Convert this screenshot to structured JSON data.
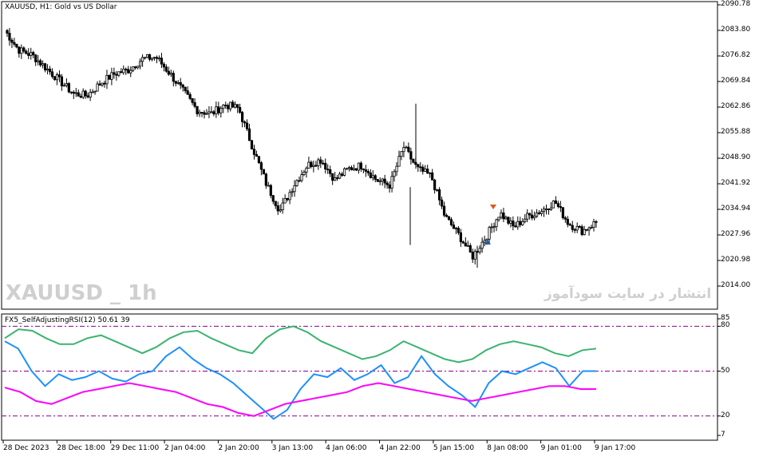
{
  "main_chart": {
    "title": "XAUUSD, H1:  Gold vs US Dollar",
    "price_ticks": [
      "2090.78",
      "2083.80",
      "2076.82",
      "2069.84",
      "2062.86",
      "2055.88",
      "2048.90",
      "2041.92",
      "2034.94",
      "2027.96",
      "2020.98",
      "2014.00"
    ],
    "watermark_left": "XAUUSD _ 1h",
    "watermark_right": "انتشار در سایت سودآموز"
  },
  "indicator": {
    "title": "FX5_SelfAdjustingRSI(12) 50.61 39",
    "ticks": [
      "85",
      "80",
      "50",
      "20",
      "7"
    ],
    "colors": {
      "rsi": "#1e90ff",
      "upper_band": "#3cb371",
      "lower_band": "#ff00ff",
      "levels": "#8b008b"
    }
  },
  "time_axis": [
    "28 Dec 2023",
    "28 Dec 18:00",
    "29 Dec 11:00",
    "2 Jan 04:00",
    "2 Jan 20:00",
    "3 Jan 13:00",
    "4 Jan 06:00",
    "4 Jan 22:00",
    "5 Jan 15:00",
    "8 Jan 08:00",
    "9 Jan 01:00",
    "9 Jan 17:00"
  ],
  "chart_data": [
    {
      "type": "candlestick",
      "title": "XAUUSD, H1:  Gold vs US Dollar",
      "ylim": [
        2014.0,
        2090.78
      ],
      "x": [
        "28 Dec 2023",
        "28 Dec 18:00",
        "29 Dec 11:00",
        "2 Jan 04:00",
        "2 Jan 20:00",
        "3 Jan 13:00",
        "4 Jan 06:00",
        "4 Jan 22:00",
        "5 Jan 15:00",
        "8 Jan 08:00",
        "9 Jan 01:00",
        "9 Jan 17:00"
      ],
      "close_path": [
        2083.8,
        2078.5,
        2077.0,
        2073.5,
        2070.0,
        2066.5,
        2066.0,
        2069.5,
        2072.0,
        2073.0,
        2076.0,
        2076.5,
        2072.0,
        2067.0,
        2062.0,
        2061.0,
        2063.5,
        2062.5,
        2052.0,
        2042.0,
        2034.5,
        2041.5,
        2047.0,
        2048.5,
        2043.0,
        2046.0,
        2047.0,
        2043.0,
        2041.5,
        2052.0,
        2046.0,
        2044.0,
        2033.0,
        2028.0,
        2022.0,
        2027.5,
        2034.0,
        2030.0,
        2033.0,
        2034.5,
        2037.0,
        2031.0,
        2029.0,
        2031.5
      ]
    },
    {
      "type": "line",
      "title": "FX5_SelfAdjustingRSI(12) 50.61 39",
      "ylim": [
        7,
        85
      ],
      "levels": [
        80,
        50,
        20
      ],
      "series": [
        {
          "values": [
            70,
            65,
            50,
            40,
            48,
            44,
            46,
            50,
            45,
            43,
            48,
            50,
            60,
            66,
            58,
            52,
            48,
            42,
            34,
            26,
            18,
            24,
            38,
            48,
            46,
            52,
            44,
            48,
            54,
            42,
            46,
            60,
            48,
            40,
            34,
            26,
            42,
            50,
            48,
            52,
            56,
            52,
            40,
            50,
            50
          ]
        },
        {
          "values": [
            72,
            78,
            77,
            72,
            68,
            68,
            72,
            74,
            70,
            66,
            62,
            66,
            72,
            76,
            77,
            72,
            68,
            64,
            62,
            72,
            78,
            80,
            76,
            70,
            66,
            62,
            58,
            60,
            64,
            70,
            66,
            62,
            58,
            56,
            58,
            64,
            68,
            70,
            68,
            66,
            62,
            60,
            64,
            65
          ]
        },
        {
          "values": [
            39,
            36,
            30,
            28,
            32,
            36,
            38,
            40,
            42,
            40,
            38,
            36,
            32,
            28,
            26,
            22,
            20,
            24,
            28,
            30,
            32,
            34,
            36,
            40,
            42,
            40,
            38,
            36,
            34,
            32,
            30,
            32,
            34,
            36,
            38,
            40,
            40,
            38,
            38
          ]
        }
      ]
    }
  ]
}
